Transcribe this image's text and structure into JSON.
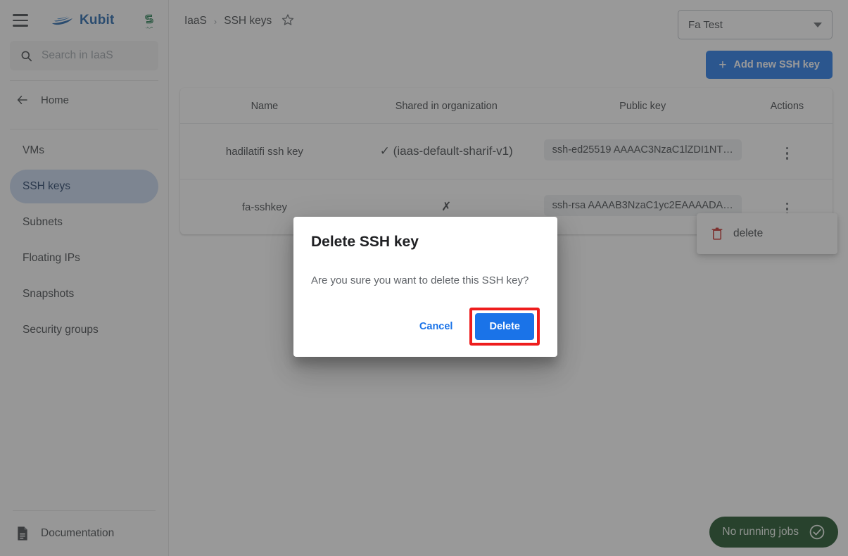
{
  "sidebar": {
    "menu_icon": "hamburger-icon",
    "brand": "Kubit",
    "org_logo_caption": "شریف",
    "search": {
      "placeholder": "Search in IaaS",
      "value": "",
      "icon": "search-icon"
    },
    "home": {
      "label": "Home",
      "icon": "arrow-left-icon"
    },
    "items": [
      {
        "label": "VMs",
        "active": false
      },
      {
        "label": "SSH keys",
        "active": true
      },
      {
        "label": "Subnets",
        "active": false
      },
      {
        "label": "Floating IPs",
        "active": false
      },
      {
        "label": "Snapshots",
        "active": false
      },
      {
        "label": "Security groups",
        "active": false
      }
    ],
    "documentation": {
      "label": "Documentation",
      "icon": "document-icon"
    }
  },
  "header": {
    "breadcrumb": [
      "IaaS",
      "SSH keys"
    ],
    "breadcrumb_separator": "›",
    "favorite_icon": "star-icon",
    "project_select": {
      "value": "Fa Test",
      "icon": "chevron-down-icon"
    },
    "add_button": {
      "label": "Add new SSH key",
      "icon": "plus-icon"
    }
  },
  "table": {
    "columns": [
      "Name",
      "Shared in organization",
      "Public key",
      "Actions"
    ],
    "rows": [
      {
        "name": "hadilatifi ssh key",
        "shared": "✓ (iaas-default-sharif-v1)",
        "public_key": "ssh-ed25519 AAAAC3NzaC1lZDI1NT…",
        "actions_icon": "kebab-menu-icon"
      },
      {
        "name": "fa-sshkey",
        "shared": "✗",
        "public_key": "ssh-rsa AAAAB3NzaC1yc2EAAAADA…",
        "actions_icon": "kebab-menu-icon"
      }
    ]
  },
  "action_menu": {
    "items": [
      {
        "label": "delete",
        "icon": "trash-icon",
        "color": "#c5221f"
      }
    ]
  },
  "dialog": {
    "title": "Delete SSH key",
    "message": "Are you sure you want to delete this SSH key?",
    "cancel_label": "Cancel",
    "delete_label": "Delete",
    "highlighted": "delete-button"
  },
  "status": {
    "jobs_label": "No running jobs",
    "jobs_icon": "check-circle-icon"
  },
  "colors": {
    "brand_blue": "#1a5fa8",
    "accent_blue": "#1a73e8",
    "active_nav": "#c5d6ee",
    "delete_red": "#c5221f",
    "highlight_red": "#ee1d1d",
    "jobs_green": "#14491f"
  }
}
